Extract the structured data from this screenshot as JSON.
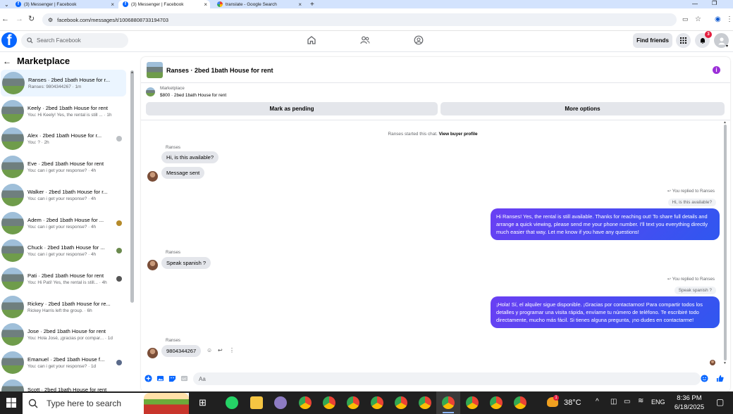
{
  "browser": {
    "tabs": [
      {
        "title": "(3) Messenger | Facebook",
        "icon": "facebook-icon",
        "active": false
      },
      {
        "title": "(3) Messenger | Facebook",
        "icon": "facebook-icon",
        "active": true
      },
      {
        "title": "translate - Google Search",
        "icon": "google-icon",
        "active": false
      }
    ],
    "url": "facebook.com/messages/t/10068808733194703"
  },
  "header": {
    "search_placeholder": "Search Facebook",
    "find_friends": "Find friends",
    "notification_count": "3"
  },
  "sidebar": {
    "title": "Marketplace",
    "conversations": [
      {
        "name": "Ranses · 2bed 1bath House for r...",
        "preview": "Ranses: 9804344267 · 1m",
        "bold": false,
        "selected": true
      },
      {
        "name": "Keely · 2bed 1bath House for rent",
        "preview": "You: Hi Keely! Yes, the rental is still ... · 1h",
        "bold": false
      },
      {
        "name": "Alex · 2bed 1bath House for r...",
        "preview": "You: ? · 2h",
        "bold": false
      },
      {
        "name": "Eve · 2bed 1bath House for rent",
        "preview": "You: can i get your response? · 4h",
        "bold": false
      },
      {
        "name": "Walker · 2bed 1bath House for r...",
        "preview": "You: can i get your response? · 4h",
        "bold": false
      },
      {
        "name": "Adem · 2bed 1bath House for ...",
        "preview": "You: can i get your response? · 4h",
        "bold": false
      },
      {
        "name": "Chuck · 2bed 1bath House for ...",
        "preview": "You: can i get your response? · 4h",
        "bold": false
      },
      {
        "name": "Pati · 2bed 1bath House for rent",
        "preview": "You: Hi Pati! Yes, the rental is still... · 4h",
        "bold": false
      },
      {
        "name": "Rickey · 2bed 1bath House for re...",
        "preview": "Rickey Harris left the group. · 6h",
        "bold": false
      },
      {
        "name": "Jose · 2bed 1bath House for rent",
        "preview": "You: Hola José, ¡gracias por compar... · 1d",
        "bold": false
      },
      {
        "name": "Emanuel · 2bed 1bath House f...",
        "preview": "You: can i get your response? · 1d",
        "bold": false
      },
      {
        "name": "Scott · 2bed 1bath House for rent",
        "preview": "",
        "bold": false
      }
    ]
  },
  "chat": {
    "title": "Ranses · 2bed 1bath House for rent",
    "marketplace_label": "Marketplace",
    "listing": "$800 · 2bed 1bath House for rent",
    "mark_pending": "Mark as pending",
    "more_options": "More options",
    "started_text": "Ranses started this chat.",
    "view_profile": "View buyer profile",
    "sender_name": "Ranses",
    "msg1": "Hi, is this available?",
    "msg2": "Message sent",
    "replied1": "You replied to Ranses",
    "quote1": "Hi, is this available?",
    "reply1": "Hi Ranses! Yes, the rental is still available. Thanks for reaching out! To share full details and arrange a quick viewing, please send me your phone number. I'll text you everything directly much easier that way. Let me know if you have any questions!",
    "msg3": "Speak spanish ?",
    "replied2": "You replied to Ranses",
    "quote2": "Speak spanish ?",
    "reply2": "¡Hola! Sí, el alquiler sigue disponible. ¡Gracias por contactarnos! Para compartir todos los detalles y programar una visita rápida, envíame tu número de teléfono. Te escribiré todo directamente, mucho más fácil. Si tienes alguna pregunta, ¡no dudes en contactarme!",
    "msg4": "9804344267",
    "composer_placeholder": "Aa"
  },
  "taskbar": {
    "search_placeholder": "Type here to search",
    "weather": "38°C",
    "weather_badge": "1",
    "language": "ENG",
    "time": "8:36 PM",
    "date": "6/18/2025"
  },
  "colors": {
    "facebook_blue": "#0866ff",
    "outgoing_bubble": "#5b3af2",
    "incoming_bubble": "#e4e6eb",
    "selected_conversation": "#ebf5ff"
  }
}
